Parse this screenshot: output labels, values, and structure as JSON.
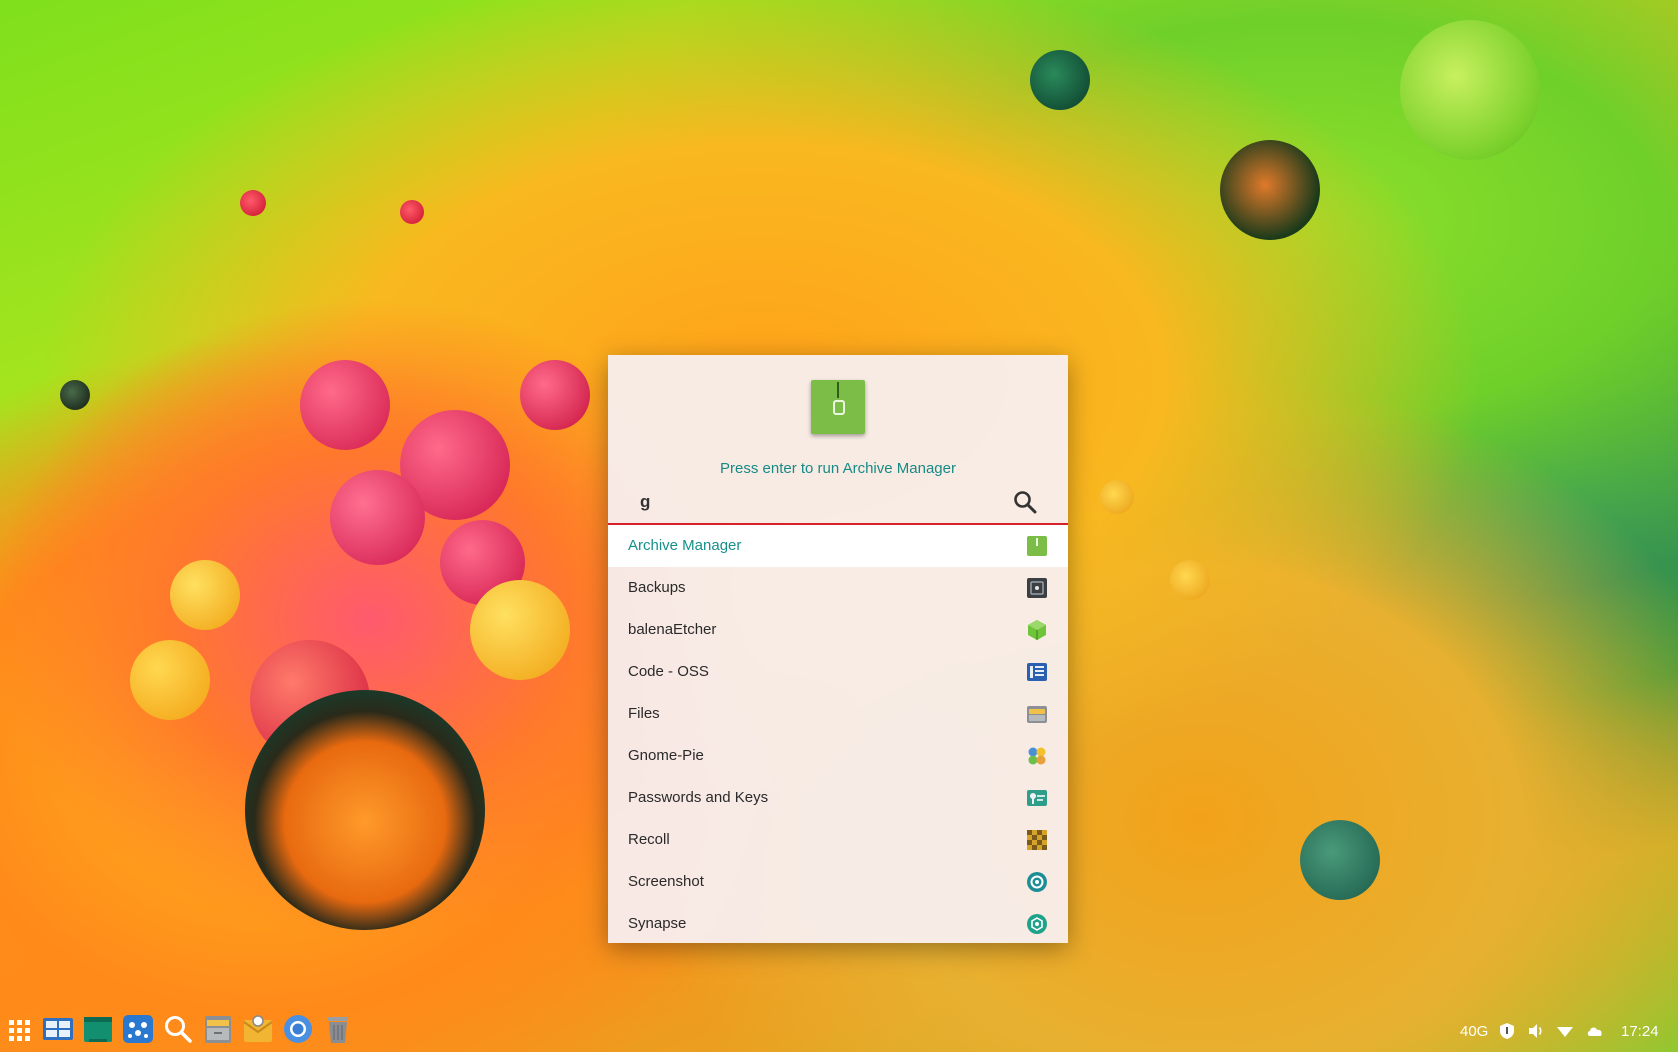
{
  "launcher": {
    "hint": "Press enter to run Archive Manager",
    "query": "g",
    "results": [
      {
        "label": "Archive Manager",
        "icon": "archive-manager-icon",
        "selected": true
      },
      {
        "label": "Backups",
        "icon": "backups-icon",
        "selected": false
      },
      {
        "label": "balenaEtcher",
        "icon": "balena-etcher-icon",
        "selected": false
      },
      {
        "label": "Code - OSS",
        "icon": "code-oss-icon",
        "selected": false
      },
      {
        "label": "Files",
        "icon": "files-icon",
        "selected": false
      },
      {
        "label": "Gnome-Pie",
        "icon": "gnome-pie-icon",
        "selected": false
      },
      {
        "label": "Passwords and Keys",
        "icon": "passwords-keys-icon",
        "selected": false
      },
      {
        "label": "Recoll",
        "icon": "recoll-icon",
        "selected": false
      },
      {
        "label": "Screenshot",
        "icon": "screenshot-icon",
        "selected": false
      },
      {
        "label": "Synapse",
        "icon": "synapse-icon",
        "selected": false
      }
    ]
  },
  "taskbar": {
    "apps": [
      "app-grid-icon",
      "workspaces-icon",
      "terminal-icon",
      "dock-icon",
      "search-icon",
      "files-icon",
      "mail-icon",
      "chromium-icon",
      "trash-icon"
    ],
    "tray": {
      "storage": "40G",
      "clock": "17:24",
      "icons": [
        "shield-icon",
        "volume-icon",
        "wifi-icon",
        "cloud-icon"
      ]
    }
  },
  "colors": {
    "accent": "#16908b",
    "underline": "#d6212b",
    "archive_green": "#7bbd47"
  }
}
